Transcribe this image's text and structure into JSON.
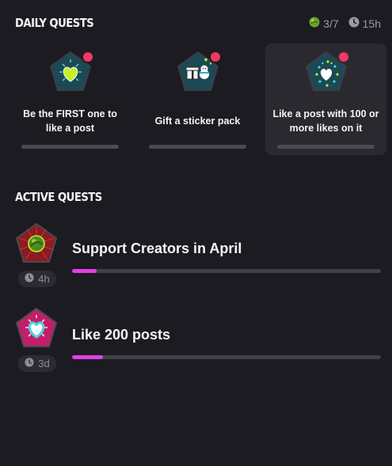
{
  "colors": {
    "background": "#1c1b21",
    "card_highlight": "#2a2930",
    "progress_fill": "#e23fe6",
    "notification": "#f03a5f",
    "muted_text": "#9a9aa2"
  },
  "daily": {
    "title": "Daily Quests",
    "progress_text": "3/7",
    "progress_icon": "green-orb-icon",
    "time_text": "15h",
    "time_icon": "clock-icon",
    "quests": [
      {
        "label": "Be the FIRST one to like a post",
        "icon": "heart-badge-icon",
        "progress": 0
      },
      {
        "label": "Gift a sticker pack",
        "icon": "gift-sticker-badge-icon",
        "progress": 0
      },
      {
        "label": "Like a post with 100 or more likes on it",
        "icon": "heart-ring-badge-icon",
        "progress": 0
      }
    ]
  },
  "active": {
    "title": "Active Quests",
    "quests": [
      {
        "label": "Support Creators in April",
        "time_text": "4h",
        "icon": "creator-support-badge-icon",
        "progress": 0.08
      },
      {
        "label": "Like 200 posts",
        "time_text": "3d",
        "icon": "heart-pink-badge-icon",
        "progress": 0.1
      }
    ]
  }
}
